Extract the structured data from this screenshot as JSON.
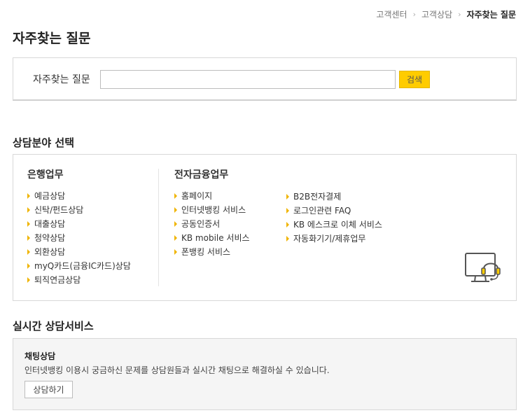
{
  "breadcrumb": {
    "items": [
      "고객센터",
      "고객상담"
    ],
    "current": "자주찾는 질문"
  },
  "page_title": "자주찾는 질문",
  "search": {
    "label": "자주찾는 질문",
    "value": "",
    "button_label": "검색"
  },
  "category_section": {
    "title": "상담분야 선택",
    "banking": {
      "heading": "은행업무",
      "items": [
        "예금상담",
        "신탁/펀드상담",
        "대출상담",
        "청약상담",
        "외환상담",
        "myQ카드(금융IC카드)상담",
        "퇴직연금상담"
      ]
    },
    "ebanking": {
      "heading": "전자금융업무",
      "items_col1": [
        "홈페이지",
        "인터넷뱅킹 서비스",
        "공동인증서",
        "KB mobile 서비스",
        "폰뱅킹 서비스"
      ],
      "items_col2": [
        "B2B전자결제",
        "로그인관련 FAQ",
        "KB 에스크로 이체 서비스",
        "자동화기기/제휴업무"
      ]
    },
    "icon": "support-monitor-headset-icon"
  },
  "live_section": {
    "title": "실시간 상담서비스",
    "chat": {
      "title": "채팅상담",
      "description": "인터넷뱅킹 이용시 궁금하신 문제를 상담원들과 실시간 채팅으로 해결하실 수 있습니다.",
      "button_label": "상담하기"
    }
  },
  "colors": {
    "accent": "#ffcc00",
    "bullet": "#f0b400",
    "border": "#d8d8d8"
  }
}
